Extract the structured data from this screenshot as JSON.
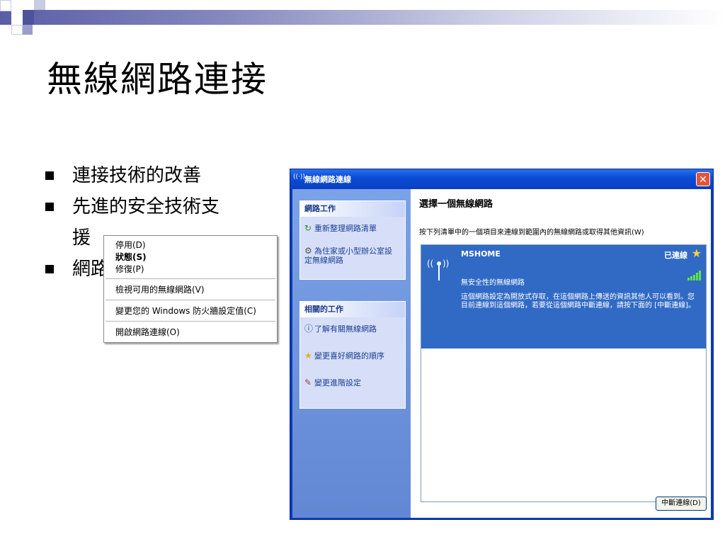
{
  "slide": {
    "title": "無線網路連接",
    "bullets": [
      "連接技術的改善",
      "先進的安全技術支",
      "援",
      "網路"
    ]
  },
  "context_menu": {
    "items": [
      "停用(D)",
      "狀態(S)",
      "修復(P)",
      "檢視可用的無線網路(V)",
      "變更您的 Windows 防火牆設定值(C)",
      "開啟網路連線(O)"
    ]
  },
  "window": {
    "title": "無線網路連線",
    "close_glyph": "✕",
    "network_tasks": {
      "header": "網路工作",
      "items": [
        {
          "label": "重新整理網路清單",
          "icon": "refresh-icon"
        },
        {
          "label": "為住家或小型辦公室設定無線網路",
          "icon": "setup-wizard-icon"
        }
      ]
    },
    "related_tasks": {
      "header": "相關的工作",
      "items": [
        {
          "label": "了解有關無線網路",
          "icon": "info-icon"
        },
        {
          "label": "變更喜好網路的順序",
          "icon": "star-icon"
        },
        {
          "label": "變更進階設定",
          "icon": "settings-icon"
        }
      ]
    },
    "main_title": "選擇一個無線網路",
    "main_desc": "按下列清單中的一個項目來連線到範圍內的無線網路或取得其他資訊(W)",
    "network": {
      "ssid": "MSHOME",
      "status": "已連線",
      "security": "無安全性的無線網路",
      "info": "這個網路設定為開放式存取，在這個網路上傳送的資訊其他人可以看到。您目前連線到這個網路，若要從這個網路中斷連線，請按下面的 [中斷連線]。",
      "signal_bars": 5
    },
    "disconnect_label": "中斷連線(D)"
  },
  "colors": {
    "xp_blue": "#0a3bb8",
    "selection": "#316ac5",
    "signal": "#5fe34a"
  }
}
